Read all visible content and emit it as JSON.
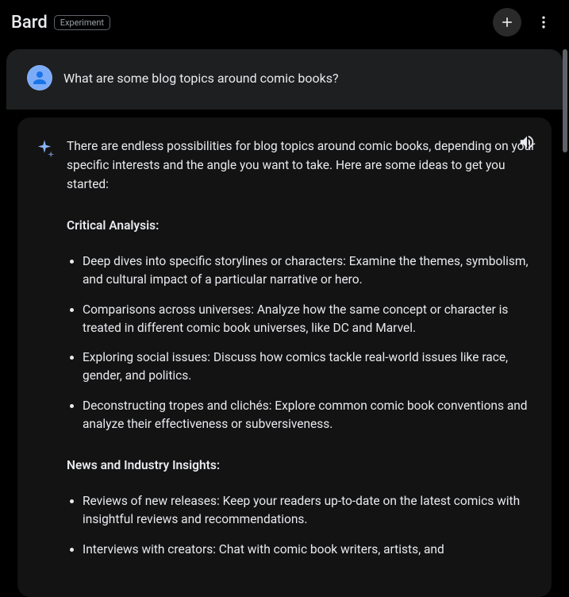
{
  "header": {
    "brand": "Bard",
    "badge": "Experiment"
  },
  "user_message": "What are some blog topics around comic books?",
  "response": {
    "intro": "There are endless possibilities for blog topics around comic books, depending on your specific interests and the angle you want to take. Here are some ideas to get you started:",
    "sections": [
      {
        "heading": "Critical Analysis:",
        "items": [
          "Deep dives into specific storylines or characters: Examine the themes, symbolism, and cultural impact of a particular narrative or hero.",
          "Comparisons across universes: Analyze how the same concept or character is treated in different comic book universes, like DC and Marvel.",
          "Exploring social issues: Discuss how comics tackle real-world issues like race, gender, and politics.",
          "Deconstructing tropes and clichés: Explore common comic book conventions and analyze their effectiveness or subversiveness."
        ]
      },
      {
        "heading": "News and Industry Insights:",
        "items": [
          "Reviews of new releases: Keep your readers up-to-date on the latest comics with insightful reviews and recommendations.",
          "Interviews with creators: Chat with comic book writers, artists, and"
        ]
      }
    ]
  }
}
